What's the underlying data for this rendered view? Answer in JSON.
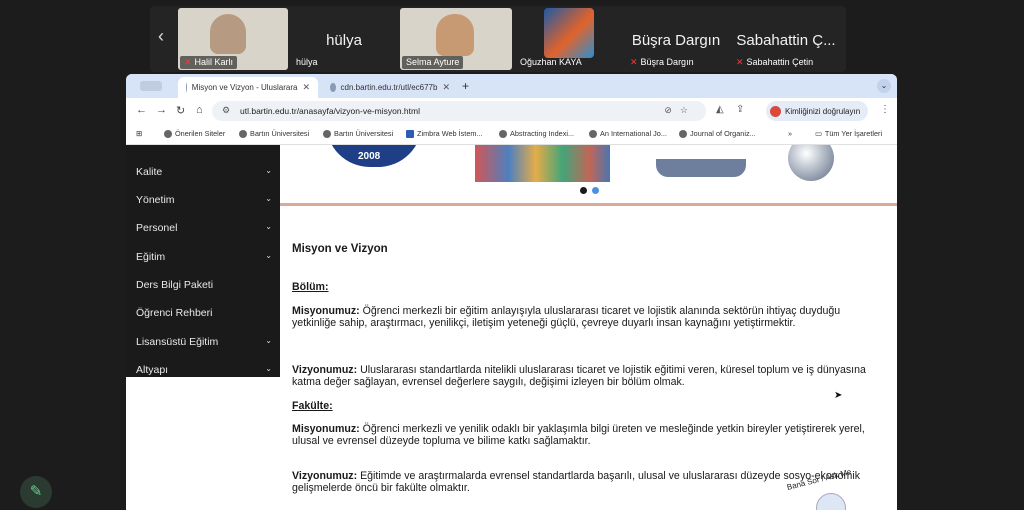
{
  "meeting": {
    "participants": [
      {
        "name": "Halil Karlı",
        "muted": true,
        "video": true
      },
      {
        "name": "hülya",
        "muted": false,
        "video": false
      },
      {
        "name": "Selma Ayture",
        "muted": false,
        "video": true
      },
      {
        "name": "Oğuzhan KAYA",
        "muted": false,
        "video": false
      },
      {
        "name": "Büşra Dargın",
        "muted": true,
        "video": false
      },
      {
        "name": "Sabahattin Çetin",
        "center_name": "Sabahattin Ç...",
        "muted": true,
        "video": false
      }
    ]
  },
  "browser": {
    "tabs": [
      {
        "title": "Misyon ve Vizyon - Uluslarara",
        "active": true
      },
      {
        "title": "cdn.bartin.edu.tr/utl/ec677b",
        "active": false
      }
    ],
    "url": "utl.bartin.edu.tr/anasayfa/vizyon-ve-misyon.html",
    "identity_button": "Kimliğinizi doğrulayın",
    "bookmarks": [
      "Önerilen Siteler",
      "Bartın Üniversitesi",
      "Bartın Üniversitesi",
      "Zimbra Web İstem...",
      "Abstracting Indexi...",
      "An International Jo...",
      "Journal of Organiz..."
    ],
    "bookmarks_more": "»",
    "all_bookmarks": "Tüm Yer İşaretleri"
  },
  "sidebar": {
    "items": [
      {
        "label": "Kalite",
        "expandable": true
      },
      {
        "label": "Yönetim",
        "expandable": true
      },
      {
        "label": "Personel",
        "expandable": true
      },
      {
        "label": "Eğitim",
        "expandable": true
      },
      {
        "label": "Ders Bilgi Paketi",
        "expandable": false
      },
      {
        "label": "Öğrenci Rehberi",
        "expandable": false
      },
      {
        "label": "Lisansüstü Eğitim",
        "expandable": true
      },
      {
        "label": "Altyapı",
        "expandable": true
      }
    ]
  },
  "banner": {
    "year": "2008",
    "slide_count": 2,
    "active_slide": 1
  },
  "content": {
    "heading": "Misyon ve Vizyon",
    "sections": [
      {
        "title": "Bölüm:",
        "paragraphs": [
          {
            "label": "Misyonumuz:",
            "text": " Öğrenci merkezli bir eğitim anlayışıyla uluslararası ticaret ve lojistik alanında sektörün ihtiyaç duyduğu yetkinliğe sahip, araştırmacı, yenilikçi, iletişim yeteneği güçlü, çevreye duyarlı insan kaynağını yetiştirmektir."
          },
          {
            "label": "Vizyonumuz:",
            "text": " Uluslararası standartlarda nitelikli uluslararası ticaret ve lojistik eğitimi veren, küresel toplum ve iş dünyasına katma değer sağlayan, evrensel değerlere saygılı, değişimi izleyen bir bölüm olmak."
          }
        ]
      },
      {
        "title": "Fakülte:",
        "paragraphs": [
          {
            "label": "Misyonumuz:",
            "text": " Öğrenci merkezli ve yenilik odaklı bir yaklaşımla bilgi üreten ve mesleğinde yetkin bireyler yetiştirerek yerel, ulusal ve evrensel düzeyde topluma ve bilime katkı sağlamaktır."
          },
          {
            "label": "Vizyonumuz:",
            "text": " Eğitimde ve araştırmalarda evrensel standartlarda başarılı, ulusal ve uluslararası düzeyde sosyo-ekonomik gelişmelerde öncü bir fakülte olmaktır."
          }
        ]
      }
    ]
  },
  "floating_widget": {
    "text": "Bana Sor / Ask Me"
  },
  "colors": {
    "sidebar_bg": "#1a1a1a",
    "tabbar_bg": "#d7e3f6",
    "divider": "#d9a99a",
    "logo_blue": "#1e3f86",
    "dot_active": "#1a1a1a",
    "dot_inactive": "#4a90e2",
    "mic_off": "#e04141"
  },
  "icons": {
    "edit_button": "pencil-icon",
    "strip_prev": "chevron-left-icon"
  }
}
